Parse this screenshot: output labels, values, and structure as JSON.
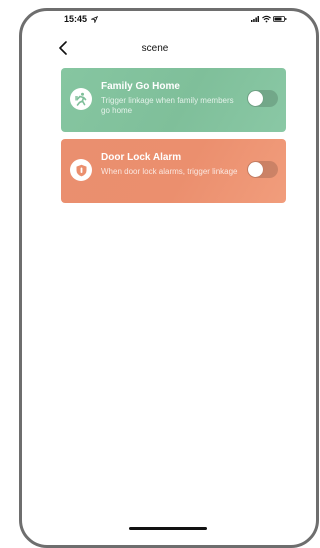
{
  "status_bar": {
    "time": "15:45"
  },
  "header": {
    "title": "scene"
  },
  "scenes": [
    {
      "title": "Family Go Home",
      "description": "Trigger linkage when family members go home",
      "icon": "person-running-icon",
      "enabled": false,
      "color": "#7fbf9a"
    },
    {
      "title": "Door Lock Alarm",
      "description": "When door lock alarms, trigger linkage",
      "icon": "shield-icon",
      "enabled": false,
      "color": "#eb8f6e"
    }
  ]
}
